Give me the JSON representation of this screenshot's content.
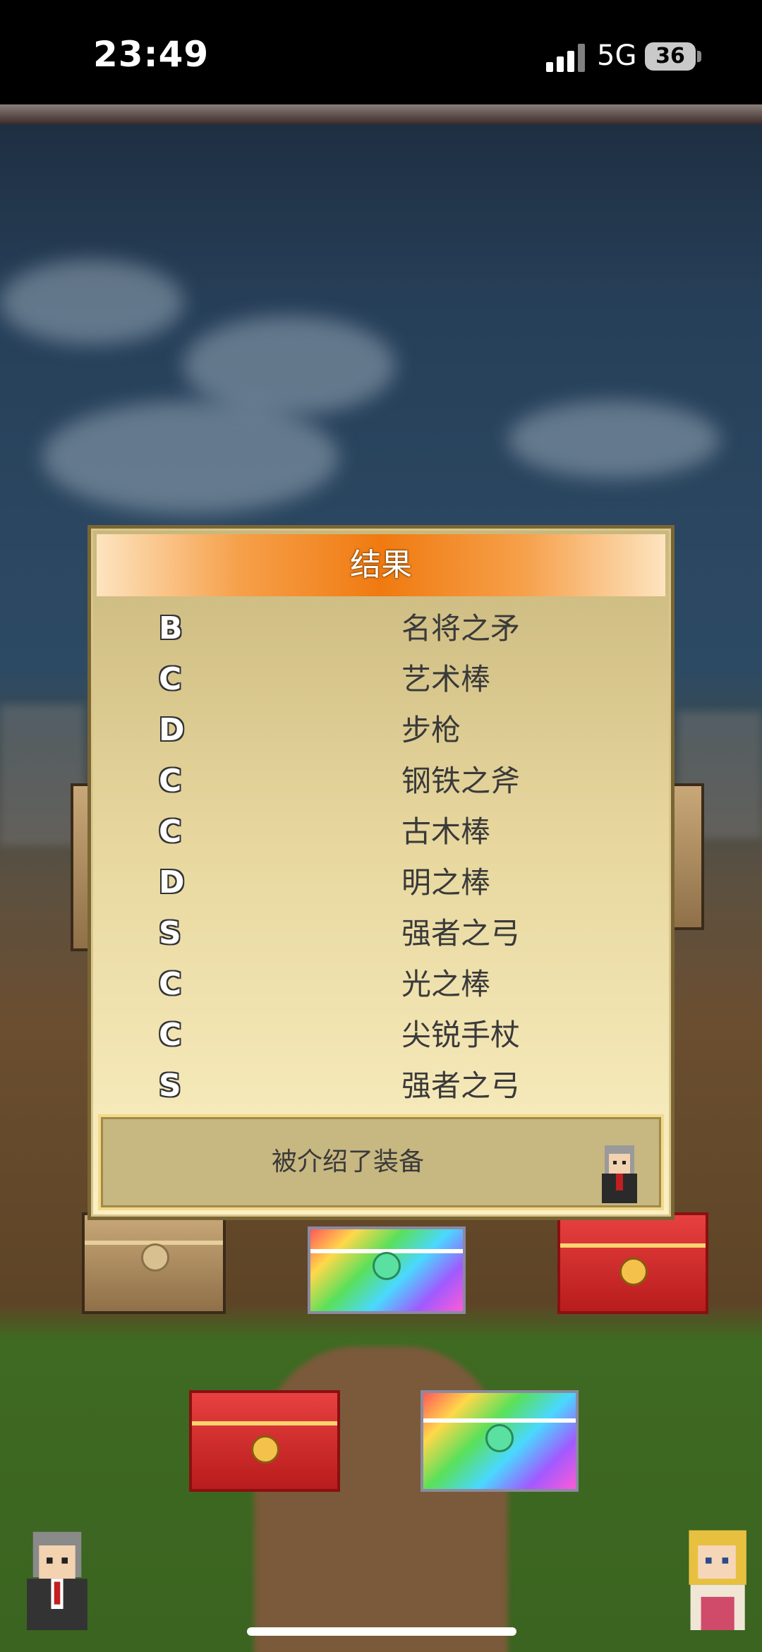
{
  "status_bar": {
    "time": "23:49",
    "network": "5G",
    "battery": "36"
  },
  "dialog": {
    "title": "结果",
    "results": [
      {
        "grade": "B",
        "item": "名将之矛"
      },
      {
        "grade": "C",
        "item": "艺术棒"
      },
      {
        "grade": "D",
        "item": "步枪"
      },
      {
        "grade": "C",
        "item": "钢铁之斧"
      },
      {
        "grade": "C",
        "item": "古木棒"
      },
      {
        "grade": "D",
        "item": "明之棒"
      },
      {
        "grade": "S",
        "item": "强者之弓"
      },
      {
        "grade": "C",
        "item": "光之棒"
      },
      {
        "grade": "C",
        "item": "尖锐手杖"
      },
      {
        "grade": "S",
        "item": "强者之弓"
      }
    ],
    "message": "被介绍了装备"
  },
  "colors": {
    "header_orange": "#f07a10",
    "panel_top": "#c9b77c",
    "panel_bottom": "#fbf0c4"
  }
}
